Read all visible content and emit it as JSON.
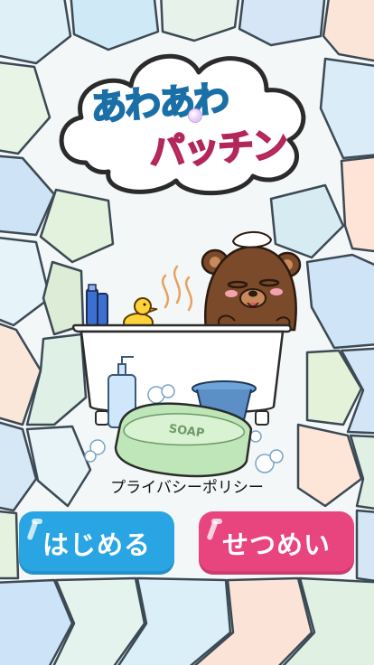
{
  "logo": {
    "line1": "あわあわ",
    "line2": "パッチン"
  },
  "scene": {
    "soap_label": "SOAP"
  },
  "privacy_link": "プライバシーポリシー",
  "buttons": {
    "start_label": "はじめる",
    "instructions_label": "せつめい"
  },
  "colors": {
    "start_button": "#2aa5e4",
    "instructions_button": "#e8457f",
    "logo_line1": "#39c3ea",
    "logo_line2": "#ff6fa3"
  }
}
